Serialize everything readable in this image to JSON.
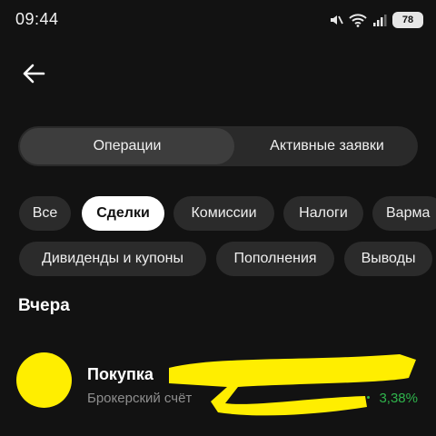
{
  "status_bar": {
    "time": "09:44",
    "battery": "78",
    "icons": [
      "mute-icon",
      "wifi-icon",
      "signal-icon",
      "battery-icon"
    ]
  },
  "nav": {
    "back_icon": "arrow-left-icon"
  },
  "tabs": [
    {
      "label": "Операции",
      "active": true
    },
    {
      "label": "Активные заявки",
      "active": false
    }
  ],
  "filters": {
    "row1": [
      "Все",
      "Сделки",
      "Комиссии",
      "Налоги",
      "Варма"
    ],
    "row2": [
      "Дивиденды и купоны",
      "Пополнения",
      "Выводы"
    ],
    "selected": "Сделки"
  },
  "section": {
    "title": "Вчера"
  },
  "operation": {
    "title": "Покупка",
    "subtitle": "Брокерский счёт",
    "change": "3,38%"
  },
  "colors": {
    "background": "#121212",
    "chip": "#2b2b2b",
    "selected_chip": "#ffffff",
    "positive": "#2fb44c",
    "redaction": "#ffee00"
  }
}
